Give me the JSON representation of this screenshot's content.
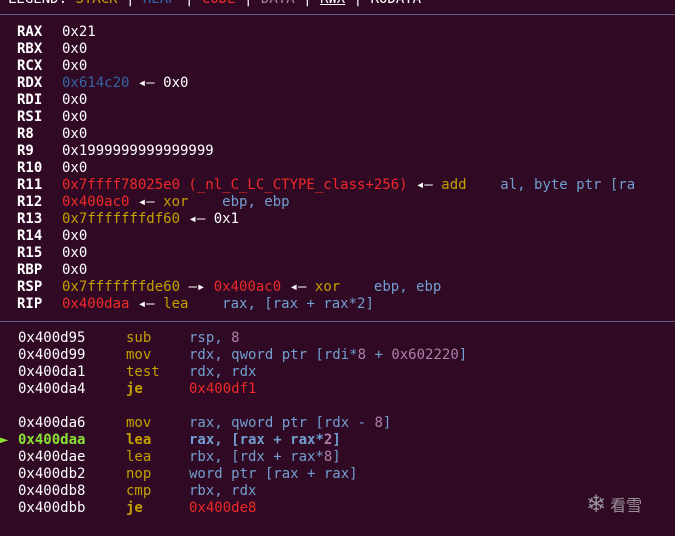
{
  "legend": {
    "prefix": "LEGEND: ",
    "items": [
      {
        "label": "STACK",
        "color": "#c4a000"
      },
      {
        "label": "HEAP",
        "color": "#3465a4"
      },
      {
        "label": "CODE",
        "color": "#ef2929"
      },
      {
        "label": "DATA",
        "color": "#ad7fa8"
      },
      {
        "label": "RWX",
        "color": "#ffffff"
      },
      {
        "label": "RODATA",
        "color": "#ffffff"
      }
    ],
    "separator": " | "
  },
  "registers": [
    {
      "name": "RAX",
      "parts": [
        {
          "t": "0x21",
          "c": "white"
        }
      ]
    },
    {
      "name": "RBX",
      "parts": [
        {
          "t": "0x0",
          "c": "white"
        }
      ]
    },
    {
      "name": "RCX",
      "parts": [
        {
          "t": "0x0",
          "c": "white"
        }
      ]
    },
    {
      "name": "RDX",
      "parts": [
        {
          "t": "0x614c20",
          "c": "blue"
        },
        {
          "t": " ◂— 0x0",
          "c": "white"
        }
      ]
    },
    {
      "name": "RDI",
      "parts": [
        {
          "t": "0x0",
          "c": "white"
        }
      ]
    },
    {
      "name": "RSI",
      "parts": [
        {
          "t": "0x0",
          "c": "white"
        }
      ]
    },
    {
      "name": "R8",
      "parts": [
        {
          "t": "0x0",
          "c": "white"
        }
      ]
    },
    {
      "name": "R9",
      "parts": [
        {
          "t": "0x1999999999999999",
          "c": "white"
        }
      ]
    },
    {
      "name": "R10",
      "parts": [
        {
          "t": "0x0",
          "c": "white"
        }
      ]
    },
    {
      "name": "R11",
      "parts": [
        {
          "t": "0x7ffff78025e0 (_nl_C_LC_CTYPE_class+256)",
          "c": "red"
        },
        {
          "t": " ◂— ",
          "c": "white"
        },
        {
          "t": "add",
          "c": "yellow"
        },
        {
          "t": "    al, byte ptr [ra",
          "c": "lblue"
        }
      ]
    },
    {
      "name": "R12",
      "parts": [
        {
          "t": "0x400ac0",
          "c": "red"
        },
        {
          "t": " ◂— ",
          "c": "white"
        },
        {
          "t": "xor",
          "c": "yellow"
        },
        {
          "t": "    ebp, ebp",
          "c": "lblue"
        }
      ]
    },
    {
      "name": "R13",
      "parts": [
        {
          "t": "0x7fffffffdf60",
          "c": "yellow"
        },
        {
          "t": " ◂— 0x1",
          "c": "white"
        }
      ]
    },
    {
      "name": "R14",
      "parts": [
        {
          "t": "0x0",
          "c": "white"
        }
      ]
    },
    {
      "name": "R15",
      "parts": [
        {
          "t": "0x0",
          "c": "white"
        }
      ]
    },
    {
      "name": "RBP",
      "parts": [
        {
          "t": "0x0",
          "c": "white"
        }
      ]
    },
    {
      "name": "RSP",
      "parts": [
        {
          "t": "0x7fffffffde60",
          "c": "yellow"
        },
        {
          "t": " —▸ ",
          "c": "white"
        },
        {
          "t": "0x400ac0",
          "c": "red"
        },
        {
          "t": " ◂— ",
          "c": "white"
        },
        {
          "t": "xor",
          "c": "yellow"
        },
        {
          "t": "    ebp, ebp",
          "c": "lblue"
        }
      ]
    },
    {
      "name": "RIP",
      "parts": [
        {
          "t": "0x400daa",
          "c": "red"
        },
        {
          "t": " ◂— ",
          "c": "white"
        },
        {
          "t": "lea",
          "c": "yellow"
        },
        {
          "t": "    rax, [rax + rax*2]",
          "c": "lblue"
        }
      ]
    }
  ],
  "disasm": [
    {
      "addr": "0x400d95",
      "mn": "sub",
      "mc": "yellow",
      "ops": [
        {
          "t": "rsp, ",
          "c": "lblue"
        },
        {
          "t": "8",
          "c": "purple"
        }
      ]
    },
    {
      "addr": "0x400d99",
      "mn": "mov",
      "mc": "yellow",
      "ops": [
        {
          "t": "rdx, qword ptr [rdi*",
          "c": "lblue"
        },
        {
          "t": "8",
          "c": "purple"
        },
        {
          "t": " + ",
          "c": "lblue"
        },
        {
          "t": "0x602220",
          "c": "purple"
        },
        {
          "t": "]",
          "c": "lblue"
        }
      ]
    },
    {
      "addr": "0x400da1",
      "mn": "test",
      "mc": "yellow",
      "ops": [
        {
          "t": "rdx, rdx",
          "c": "lblue"
        }
      ]
    },
    {
      "addr": "0x400da4",
      "mn": "je",
      "mc": "yellow",
      "bold": true,
      "ops": [
        {
          "t": "0x400df1",
          "c": "red"
        }
      ]
    },
    {
      "blank": true
    },
    {
      "addr": "0x400da6",
      "mn": "mov",
      "mc": "yellow",
      "ops": [
        {
          "t": "rax, qword ptr [rdx - ",
          "c": "lblue"
        },
        {
          "t": "8",
          "c": "purple"
        },
        {
          "t": "]",
          "c": "lblue"
        }
      ]
    },
    {
      "addr": "0x400daa",
      "current": true,
      "marker": "►",
      "mn": "lea",
      "mc": "yellow",
      "ops": [
        {
          "t": "rax, [",
          "c": "lblue"
        },
        {
          "t": "rax",
          "c": "lblue"
        },
        {
          "t": " + ",
          "c": "lblue"
        },
        {
          "t": "rax",
          "c": "lblue"
        },
        {
          "t": "*",
          "c": "lblue"
        },
        {
          "t": "2",
          "c": "purple"
        },
        {
          "t": "]",
          "c": "lblue"
        }
      ]
    },
    {
      "addr": "0x400dae",
      "mn": "lea",
      "mc": "yellow",
      "ops": [
        {
          "t": "rbx, [rdx + rax*",
          "c": "lblue"
        },
        {
          "t": "8",
          "c": "purple"
        },
        {
          "t": "]",
          "c": "lblue"
        }
      ]
    },
    {
      "addr": "0x400db2",
      "mn": "nop",
      "mc": "yellow",
      "ops": [
        {
          "t": "word ptr [rax + rax]",
          "c": "lblue"
        }
      ]
    },
    {
      "addr": "0x400db8",
      "mn": "cmp",
      "mc": "yellow",
      "ops": [
        {
          "t": "rbx, rdx",
          "c": "lblue"
        }
      ]
    },
    {
      "addr": "0x400dbb",
      "mn": "je",
      "mc": "yellow",
      "bold": true,
      "ops": [
        {
          "t": "0x400de8",
          "c": "red"
        }
      ]
    }
  ],
  "watermark": {
    "icon": "snowflake-icon",
    "text": "看雪"
  }
}
